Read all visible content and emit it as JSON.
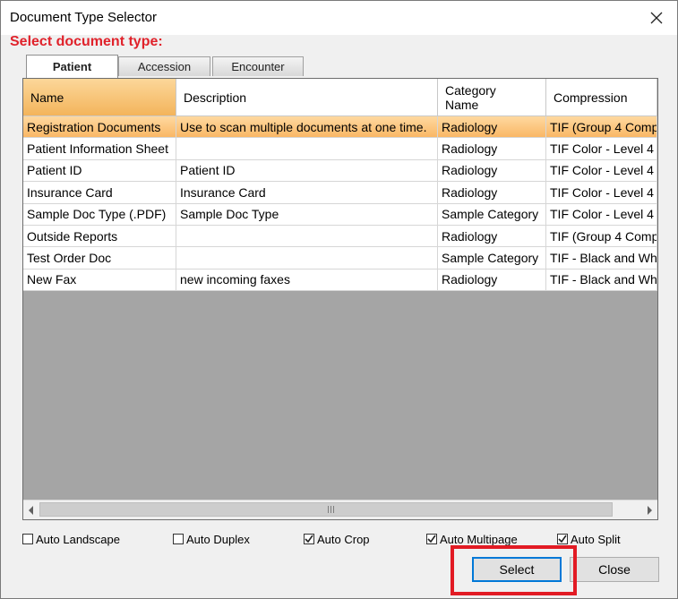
{
  "window": {
    "title": "Document Type Selector",
    "close_icon": "close-icon"
  },
  "heading": "Select document type:",
  "tabs": [
    {
      "label": "Patient",
      "active": true
    },
    {
      "label": "Accession",
      "active": false
    },
    {
      "label": "Encounter",
      "active": false
    }
  ],
  "table": {
    "columns": [
      "Name",
      "Description",
      "Category Name",
      "Compression"
    ],
    "rows": [
      {
        "name": "Registration Documents",
        "description": "Use to scan multiple documents at one time.",
        "category": "Radiology",
        "compression": "TIF (Group 4 Comp",
        "selected": true
      },
      {
        "name": "Patient Information Sheet",
        "description": "",
        "category": "Radiology",
        "compression": "TIF Color - Level 4",
        "selected": false
      },
      {
        "name": "Patient ID",
        "description": "Patient ID",
        "category": "Radiology",
        "compression": "TIF Color - Level 4",
        "selected": false
      },
      {
        "name": "Insurance Card",
        "description": "Insurance Card",
        "category": "Radiology",
        "compression": "TIF Color - Level 4",
        "selected": false
      },
      {
        "name": "Sample Doc Type (.PDF)",
        "description": "Sample Doc Type",
        "category": "Sample Category",
        "compression": "TIF Color - Level 4",
        "selected": false
      },
      {
        "name": "Outside Reports",
        "description": "",
        "category": "Radiology",
        "compression": "TIF (Group 4 Comp",
        "selected": false
      },
      {
        "name": "Test Order Doc",
        "description": "",
        "category": "Sample Category",
        "compression": "TIF - Black and Wh",
        "selected": false
      },
      {
        "name": "New Fax",
        "description": "new incoming faxes",
        "category": "Radiology",
        "compression": "TIF - Black and Wh",
        "selected": false
      }
    ]
  },
  "options": [
    {
      "label": "Auto Landscape",
      "checked": false
    },
    {
      "label": "Auto Duplex",
      "checked": false
    },
    {
      "label": "Auto Crop",
      "checked": true
    },
    {
      "label": "Auto Multipage",
      "checked": true
    },
    {
      "label": "Auto Split",
      "checked": true
    }
  ],
  "buttons": {
    "select": "Select",
    "close": "Close"
  },
  "colors": {
    "heading": "#e0222b",
    "selected_row": "#f9b765",
    "highlight": "#e21b24"
  }
}
